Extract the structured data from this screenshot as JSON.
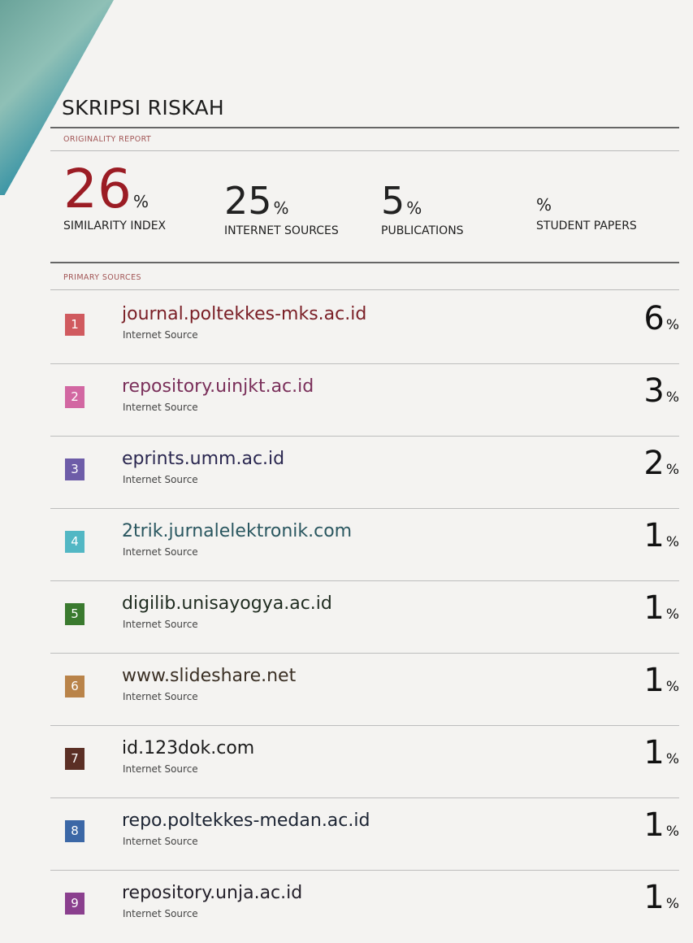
{
  "document": {
    "title": "SKRIPSI RISKAH",
    "originality_label": "ORIGINALITY REPORT",
    "primary_sources_label": "PRIMARY SOURCES"
  },
  "stats": {
    "similarity": {
      "value": "26",
      "unit": "%",
      "label": "SIMILARITY INDEX",
      "color": "#9b1c24"
    },
    "internet": {
      "value": "25",
      "unit": "%",
      "label": "INTERNET SOURCES"
    },
    "publications": {
      "value": "5",
      "unit": "%",
      "label": "PUBLICATIONS"
    },
    "student": {
      "value": "",
      "unit": "%",
      "label": "STUDENT PAPERS"
    }
  },
  "sources": [
    {
      "rank": "1",
      "name": "journal.poltekkes-mks.ac.id",
      "type": "Internet Source",
      "percent": "6",
      "unit": "%",
      "color": "#d05a5f",
      "name_color": "#7a1f26"
    },
    {
      "rank": "2",
      "name": "repository.uinjkt.ac.id",
      "type": "Internet Source",
      "percent": "3",
      "unit": "%",
      "color": "#d267a2",
      "name_color": "#7a2f5a"
    },
    {
      "rank": "3",
      "name": "eprints.umm.ac.id",
      "type": "Internet Source",
      "percent": "2",
      "unit": "%",
      "color": "#6d5ca8",
      "name_color": "#2a2750"
    },
    {
      "rank": "4",
      "name": "2trik.jurnalelektronik.com",
      "type": "Internet Source",
      "percent": "1",
      "unit": "%",
      "color": "#52b7c4",
      "name_color": "#2a5760"
    },
    {
      "rank": "5",
      "name": "digilib.unisayogya.ac.id",
      "type": "Internet Source",
      "percent": "1",
      "unit": "%",
      "color": "#3a7a2f",
      "name_color": "#1f2c20"
    },
    {
      "rank": "6",
      "name": "www.slideshare.net",
      "type": "Internet Source",
      "percent": "1",
      "unit": "%",
      "color": "#b98349",
      "name_color": "#3a2f24"
    },
    {
      "rank": "7",
      "name": "id.123dok.com",
      "type": "Internet Source",
      "percent": "1",
      "unit": "%",
      "color": "#5b2f25",
      "name_color": "#1c1c1c"
    },
    {
      "rank": "8",
      "name": "repo.poltekkes-medan.ac.id",
      "type": "Internet Source",
      "percent": "1",
      "unit": "%",
      "color": "#3b67a6",
      "name_color": "#1c2433"
    },
    {
      "rank": "9",
      "name": "repository.unja.ac.id",
      "type": "Internet Source",
      "percent": "1",
      "unit": "%",
      "color": "#8a3f8e",
      "name_color": "#24202a"
    }
  ]
}
